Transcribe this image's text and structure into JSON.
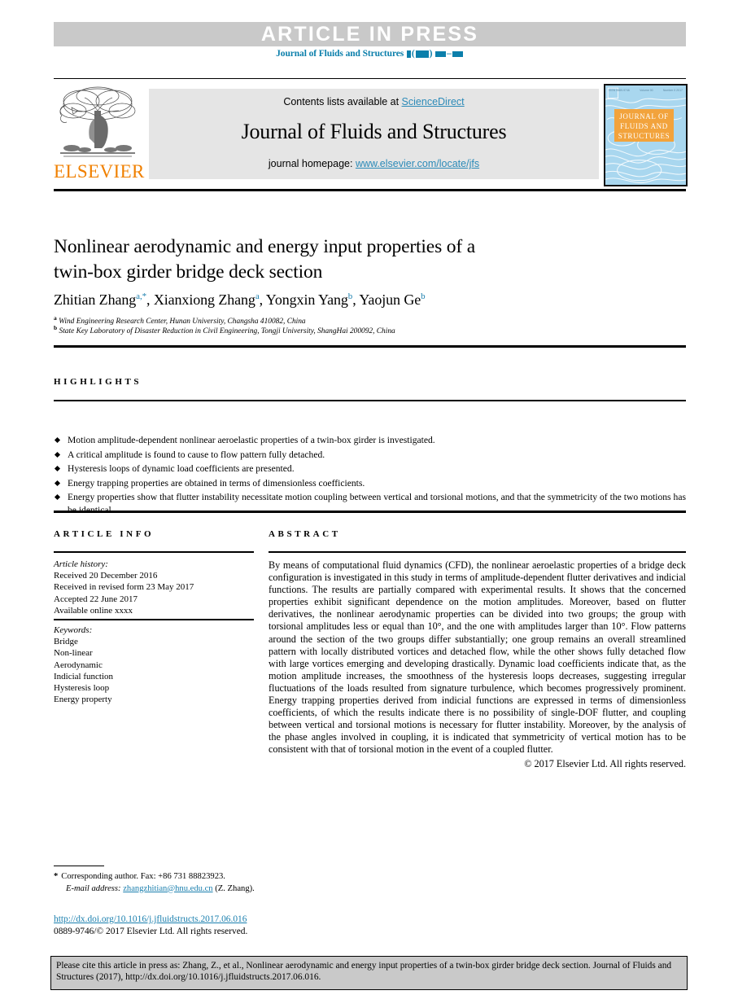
{
  "banner": {
    "article_in_press": "ARTICLE IN PRESS",
    "journal_ref_prefix": "Journal of Fluids and Structures"
  },
  "masthead": {
    "contents_prefix": "Contents lists available at ",
    "sciencedirect": "ScienceDirect",
    "journal_title": "Journal of Fluids and Structures",
    "homepage_prefix": "journal homepage: ",
    "homepage_url": "www.elsevier.com/locate/jfs",
    "publisher": "ELSEVIER",
    "cover_title_line1": "JOURNAL OF",
    "cover_title_line2": "FLUIDS AND",
    "cover_title_line3": "STRUCTURES",
    "cover_top_left": "ISSN 0889-9746",
    "cover_top_mid": "Volume 00",
    "cover_top_right": "Number 0 2017",
    "accent_orange": "#f08000",
    "accent_blue": "#1a7fae",
    "cover_blue": "#a9d7ef"
  },
  "article": {
    "title_line1": "Nonlinear aerodynamic and energy input properties of a",
    "title_line2": "twin-box girder bridge deck section",
    "authors": [
      {
        "name": "Zhitian Zhang",
        "sup": "a,*"
      },
      {
        "name": "Xianxiong Zhang",
        "sup": "a"
      },
      {
        "name": "Yongxin Yang",
        "sup": "b"
      },
      {
        "name": "Yaojun Ge",
        "sup": "b"
      }
    ],
    "affiliation_a_sup": "a",
    "affiliation_a": "Wind Engineering Research Center, Hunan University, Changsha 410082, China",
    "affiliation_b_sup": "b",
    "affiliation_b": "State Key Laboratory of Disaster Reduction in Civil Engineering, Tongji University, ShangHai 200092, China"
  },
  "highlights": {
    "label": "HIGHLIGHTS",
    "items": [
      "Motion amplitude-dependent nonlinear aeroelastic properties of a twin-box girder is investigated.",
      "A critical amplitude is found to cause to flow pattern fully detached.",
      "Hysteresis loops of dynamic load coefficients are presented.",
      "Energy trapping properties are obtained in terms of dimensionless coefficients.",
      "Energy properties show that flutter instability necessitate motion coupling between vertical and torsional motions, and that the symmetricity of the two motions has be identical."
    ]
  },
  "article_info": {
    "label": "ARTICLE INFO",
    "history_label": "Article history:",
    "history": [
      "Received 20 December 2016",
      "Received in revised form 23 May 2017",
      "Accepted 22 June 2017",
      "Available online xxxx"
    ],
    "keywords_label": "Keywords:",
    "keywords": [
      "Bridge",
      "Non-linear",
      "Aerodynamic",
      "Indicial function",
      "Hysteresis loop",
      "Energy property"
    ]
  },
  "abstract": {
    "label": "ABSTRACT",
    "text": "By means of computational fluid dynamics (CFD), the nonlinear aeroelastic properties of a bridge deck configuration is investigated in this study in terms of amplitude-dependent flutter derivatives and indicial functions. The results are partially compared with experimental results. It shows that the concerned properties exhibit significant dependence on the motion amplitudes. Moreover, based on flutter derivatives, the nonlinear aerodynamic properties can be divided into two groups; the group with torsional amplitudes less or equal than 10°, and the one with amplitudes larger than 10°. Flow patterns around the section of the two groups differ substantially; one group remains an overall streamlined pattern with locally distributed vortices and detached flow, while the other shows fully detached flow with large vortices emerging and developing drastically. Dynamic load coefficients indicate that, as the motion amplitude increases, the smoothness of the hysteresis loops decreases, suggesting irregular fluctuations of the loads resulted from signature turbulence, which becomes progressively prominent. Energy trapping properties derived from indicial functions are expressed in terms of dimensionless coefficients, of which the results indicate there is no possibility of single-DOF flutter, and coupling between vertical and torsional motions is necessary for flutter instability. Moreover, by the analysis of the phase angles involved in coupling, it is indicated that symmetricity of vertical motion has to be consistent with that of torsional motion in the event of a coupled flutter.",
    "copyright": "© 2017 Elsevier Ltd. All rights reserved."
  },
  "footnotes": {
    "star": "*",
    "corresponding": "Corresponding author. Fax: +86 731 88823923.",
    "email_label": "E-mail address:",
    "email": "zhangzhitian@hnu.edu.cn",
    "email_suffix": "(Z. Zhang).",
    "doi": "http://dx.doi.org/10.1016/j.jfluidstructs.2017.06.016",
    "issn_line": "0889-9746/© 2017 Elsevier Ltd. All rights reserved."
  },
  "cite_box": {
    "text": "Please cite this article in press as: Zhang, Z., et al., Nonlinear aerodynamic and energy input properties of a twin-box girder bridge deck section. Journal of Fluids and Structures (2017), http://dx.doi.org/10.1016/j.jfluidstructs.2017.06.016."
  }
}
